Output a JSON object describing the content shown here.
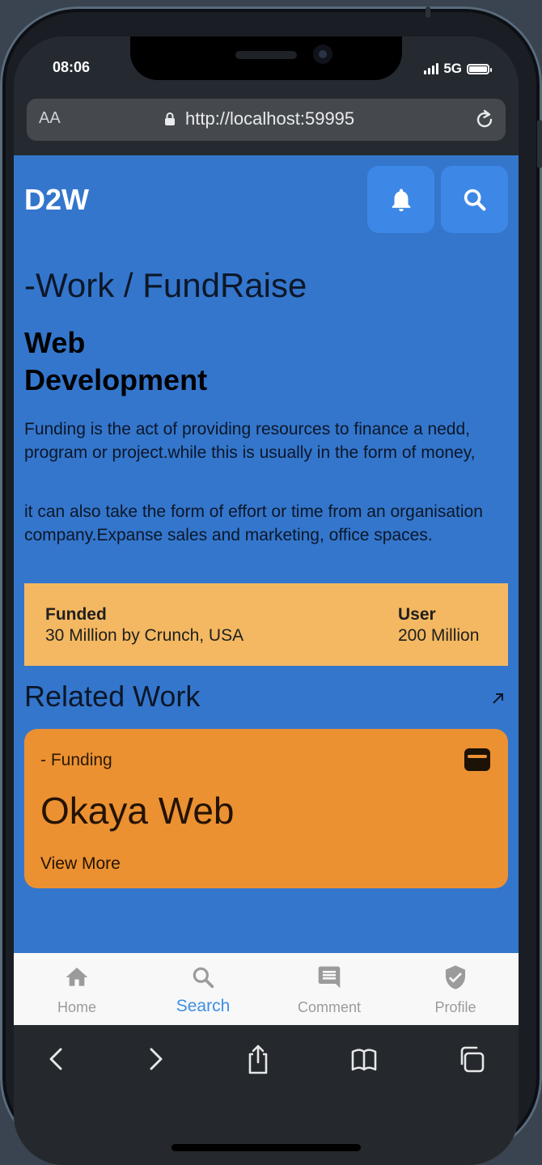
{
  "status_bar": {
    "time": "08:06",
    "network": "5G"
  },
  "browser": {
    "text_size_label": "AA",
    "url": "http://localhost:59995"
  },
  "app": {
    "logo": "D2W",
    "breadcrumb": "-Work / FundRaise",
    "title": "Web Development",
    "description_1": "Funding is the act of providing resources to finance a nedd, program or project.while this is usually in the form of money,",
    "description_2": "it can also take the form of effort or time from an organisation company.Expanse sales and marketing, office spaces.",
    "stats": [
      {
        "label": "Funded",
        "value": "30 Million by Crunch, USA"
      },
      {
        "label": "User",
        "value": "200 Million"
      }
    ],
    "related_title": "Related Work",
    "related_card": {
      "tag": "- Funding",
      "title": "Okaya Web",
      "link": "View More"
    }
  },
  "tabs": [
    {
      "label": "Home",
      "icon": "home-icon",
      "active": false
    },
    {
      "label": "Search",
      "icon": "search-icon",
      "active": true
    },
    {
      "label": "Comment",
      "icon": "comment-icon",
      "active": false
    },
    {
      "label": "Profile",
      "icon": "shield-check-icon",
      "active": false
    }
  ],
  "colors": {
    "page_background": "#3476cc",
    "header_button": "#3d87e6",
    "stats_background": "#f3b861",
    "card_background": "#eb9131",
    "tab_active": "#3c8fe2",
    "tab_inactive": "#9b9b9b"
  }
}
